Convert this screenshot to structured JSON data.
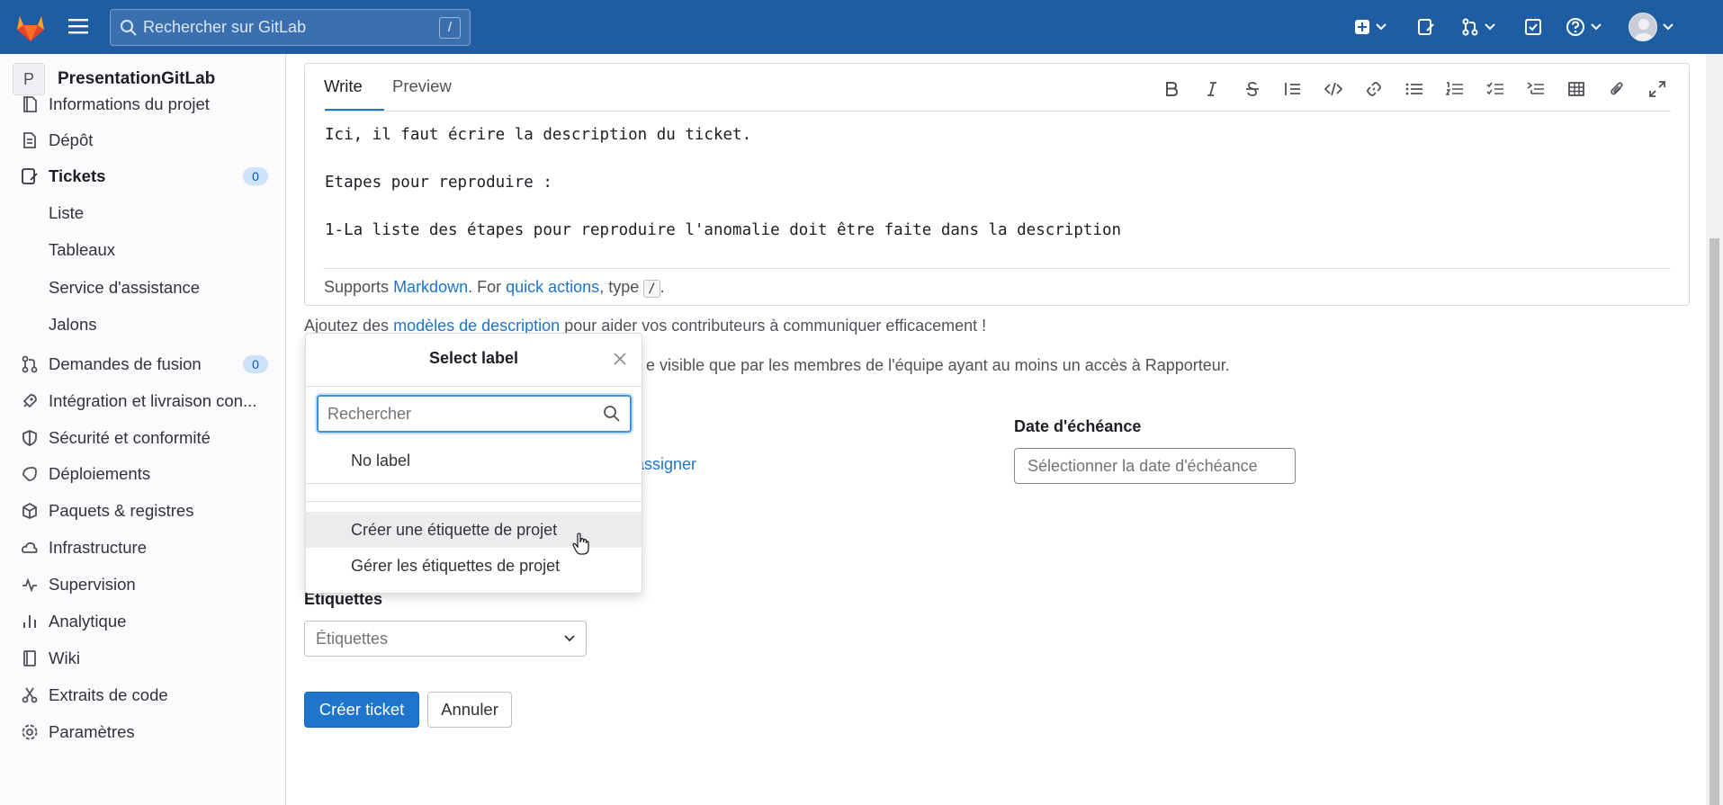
{
  "topbar": {
    "search_placeholder": "Rechercher sur GitLab",
    "search_shortcut": "/"
  },
  "sidebar": {
    "project_initial": "P",
    "project_name": "PresentationGitLab",
    "items": [
      {
        "label": "Informations du projet",
        "icon": "project-info-icon"
      },
      {
        "label": "Dépôt",
        "icon": "repository-icon"
      },
      {
        "label": "Tickets",
        "icon": "issues-icon",
        "badge": "0"
      },
      {
        "label": "Demandes de fusion",
        "icon": "merge-request-icon",
        "badge": "0"
      },
      {
        "label": "Intégration et livraison con...",
        "icon": "rocket-icon"
      },
      {
        "label": "Sécurité et conformité",
        "icon": "shield-icon"
      },
      {
        "label": "Déploiements",
        "icon": "deployments-icon"
      },
      {
        "label": "Paquets & registres",
        "icon": "package-icon"
      },
      {
        "label": "Infrastructure",
        "icon": "cloud-icon"
      },
      {
        "label": "Supervision",
        "icon": "monitor-icon"
      },
      {
        "label": "Analytique",
        "icon": "analytics-icon"
      },
      {
        "label": "Wiki",
        "icon": "book-icon"
      },
      {
        "label": "Extraits de code",
        "icon": "snippet-icon"
      },
      {
        "label": "Paramètres",
        "icon": "settings-icon"
      }
    ],
    "ticket_subitems": [
      "Liste",
      "Tableaux",
      "Service d'assistance",
      "Jalons"
    ]
  },
  "editor": {
    "tab_write": "Write",
    "tab_preview": "Preview",
    "lines": [
      "Ici, il faut écrire la description du ticket.",
      "",
      "Etapes pour reproduire :",
      "",
      "1-La liste des étapes pour reproduire l'anomalie doit être faite dans la description"
    ],
    "footer_supports": "Supports",
    "footer_markdown": "Markdown",
    "footer_for": ". For",
    "footer_quick_actions": "quick actions",
    "footer_type": ", type",
    "footer_key": "/",
    "footer_end": "."
  },
  "form": {
    "templates_prefix": "Ajoutez des",
    "templates_link": "modèles de description",
    "templates_suffix": "pour aider vos contributeurs à communiquer efficacement !",
    "confidential_text": "e visible que par les membres de l'équipe ayant au moins un accès à Rapporteur.",
    "assign_link": "assigner",
    "due_date_label": "Date d'échéance",
    "due_date_placeholder": "Sélectionner la date d'échéance",
    "labels_label": "Étiquettes",
    "labels_placeholder": "Étiquettes",
    "submit_label": "Créer ticket",
    "cancel_label": "Annuler"
  },
  "label_dropdown": {
    "title": "Select label",
    "search_placeholder": "Rechercher",
    "no_label": "No label",
    "create_label": "Créer une étiquette de projet",
    "manage_labels": "Gérer les étiquettes de projet"
  },
  "colors": {
    "topbar": "#1f5da3",
    "link": "#1f75cb",
    "primary_button": "#1f75cb",
    "badge_bg": "#cbe2f9"
  }
}
